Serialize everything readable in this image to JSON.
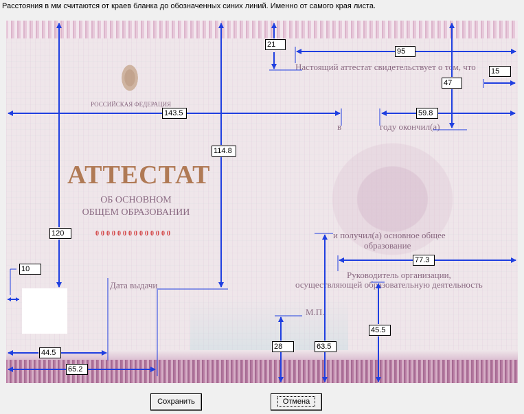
{
  "header": {
    "caption": "Расстояния в мм считаются от краев бланка до обозначенных синих линий. Именно от самого края листа."
  },
  "form": {
    "country": "РОССИЙСКАЯ ФЕДЕРАЦИЯ",
    "title": "АТТЕСТАТ",
    "subtitle": "ОБ ОСНОВНОМ ОБЩЕМ ОБРАЗОВАНИИ",
    "number": "00000000000000",
    "issue_date_label": "Дата выдачи",
    "certifies": "Настоящий аттестат свидетельствует о том, что",
    "in_label": "в",
    "year_label": "году окончил(а)",
    "received_label": "и получил(а) основное общее",
    "education_label": "образование",
    "head_label_1": "Руководитель организации,",
    "head_label_2": "осуществляющей образовательную деятельность",
    "seal_label": "М.П."
  },
  "fields": {
    "f21": "21",
    "f95": "95",
    "f15": "15",
    "f47": "47",
    "f143_5": "143.5",
    "f59_8": "59.8",
    "f114_8": "114.8",
    "f120": "120",
    "f10": "10",
    "f77_3": "77.3",
    "f45_5": "45.5",
    "f28": "28",
    "f63_5": "63.5",
    "f44_5": "44.5",
    "f65_2": "65.2"
  },
  "buttons": {
    "save": "Сохранить",
    "cancel": "Отмена"
  },
  "colors": {
    "arrow": "#1f3fe0",
    "background": "#f0f0f0"
  }
}
